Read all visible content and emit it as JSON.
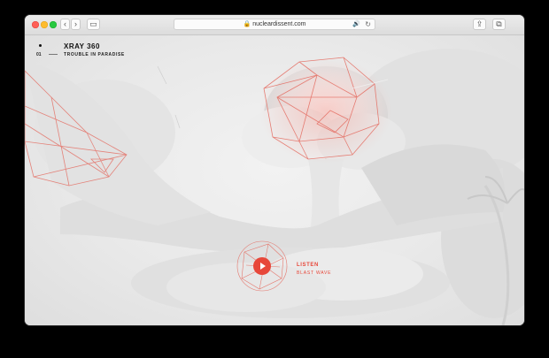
{
  "browser": {
    "url": "nucleardissent.com",
    "lock_glyph": "🔒",
    "speaker_glyph": "🔊",
    "reload_glyph": "↻",
    "back_glyph": "‹",
    "forward_glyph": "›",
    "sidebar_glyph": "▭",
    "share_glyph": "⇪",
    "tabs_glyph": "⧉",
    "new_tab_glyph": "+"
  },
  "header": {
    "number": "01",
    "title": "XRAY 360",
    "subtitle": "TROUBLE IN PARADISE"
  },
  "player": {
    "label": "LISTEN",
    "track": "BLAST WAVE",
    "accent": "#e7473a"
  },
  "nav": {
    "active_icon": "☢"
  },
  "colors": {
    "accent": "#e7473a",
    "background": "#eaeaea"
  }
}
